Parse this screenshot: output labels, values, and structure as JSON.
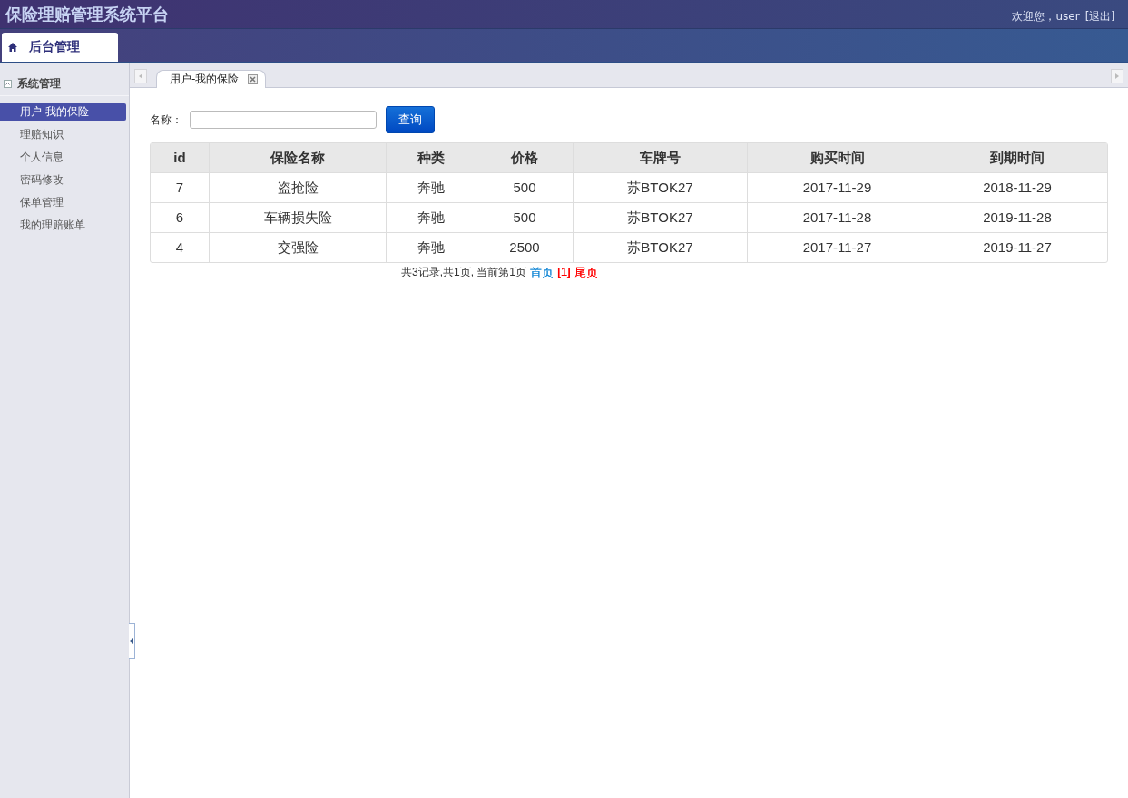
{
  "header": {
    "title": "保险理赔管理系统平台",
    "greeting": "欢迎您，user",
    "logout": "[退出]"
  },
  "top_tabs": [
    {
      "label": "后台管理",
      "selected": true
    }
  ],
  "sidebar": {
    "section": "系统管理",
    "items": [
      {
        "label": "用户-我的保险",
        "selected": true
      },
      {
        "label": "理赔知识",
        "selected": false
      },
      {
        "label": "个人信息",
        "selected": false
      },
      {
        "label": "密码修改",
        "selected": false
      },
      {
        "label": "保单管理",
        "selected": false
      },
      {
        "label": "我的理赔账单",
        "selected": false
      }
    ]
  },
  "content_tabs": [
    {
      "label": "用户-我的保险",
      "selected": true
    }
  ],
  "search": {
    "label": "名称：",
    "button": "查询"
  },
  "table": {
    "columns": [
      "id",
      "保险名称",
      "种类",
      "价格",
      "车牌号",
      "购买时间",
      "到期时间"
    ],
    "rows": [
      [
        "7",
        "盗抢险",
        "奔驰",
        "500",
        "苏BTOK27",
        "2017-11-29",
        "2018-11-29"
      ],
      [
        "6",
        "车辆损失险",
        "奔驰",
        "500",
        "苏BTOK27",
        "2017-11-28",
        "2019-11-28"
      ],
      [
        "4",
        "交强险",
        "奔驰",
        "2500",
        "苏BTOK27",
        "2017-11-27",
        "2019-11-27"
      ]
    ]
  },
  "pager": {
    "summary": "共3记录,共1页, 当前第1页",
    "links": [
      {
        "label": "首页",
        "color": "#1a8ad6"
      },
      {
        "label": "[1]",
        "color": "#ff0000"
      },
      {
        "label": "尾页",
        "color": "#ff0000"
      }
    ]
  }
}
